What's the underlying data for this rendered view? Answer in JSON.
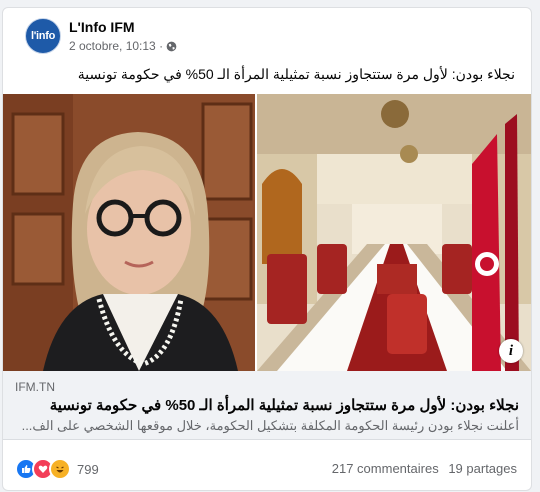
{
  "post": {
    "page_name": "L'Info IFM",
    "avatar_text": "l'info",
    "timestamp": "2 octobre, 10:13 ·",
    "caption": "نجلاء بودن: لأول مرة ستتجاوز نسبة تمثيلية المرأة الـ 50% في حكومة تونسية"
  },
  "link_preview": {
    "domain": "IFM.TN",
    "title": "نجلاء بودن: لأول مرة ستتجاوز نسبة تمثيلية المرأة الـ 50% في حكومة تونسية",
    "description": "أعلنت نجلاء بودن رئيسة الحكومة المكلفة بتشكيل الحكومة، خلال موقعها الشخصي على الف..."
  },
  "engagement": {
    "reactions_count": "799",
    "comments": "217 commentaires",
    "shares": "19 partages"
  },
  "colors": {
    "like": "#1877f2",
    "love": "#f33e58",
    "haha": "#f7b125",
    "brand": "#1e5aa8"
  },
  "icons": [
    "globe-icon",
    "info-icon",
    "like-reaction-icon",
    "love-reaction-icon",
    "haha-reaction-icon"
  ]
}
